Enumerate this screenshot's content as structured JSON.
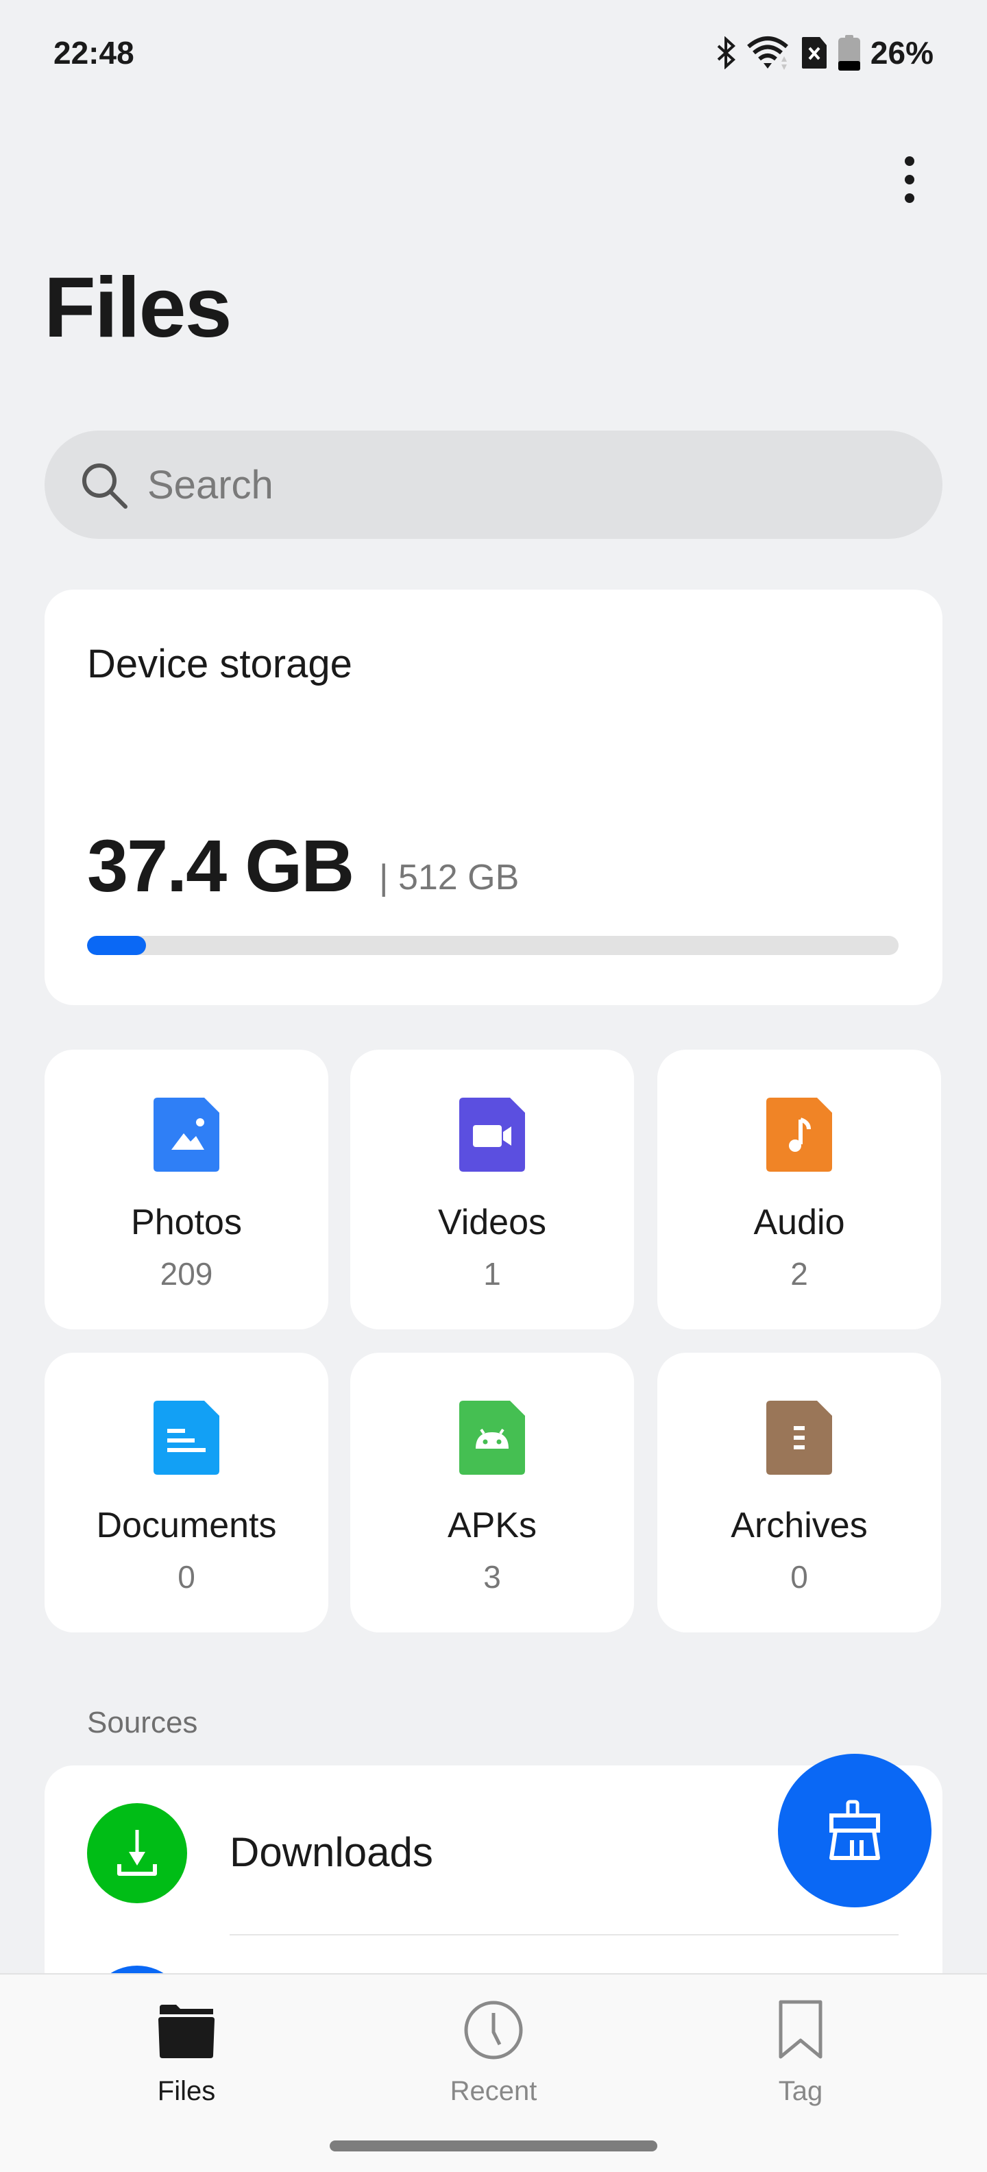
{
  "status_bar": {
    "time": "22:48",
    "battery": "26%",
    "icons": [
      "bluetooth-icon",
      "wifi-icon",
      "no-sim-icon",
      "battery-icon"
    ]
  },
  "header": {
    "title": "Files",
    "menu_icon": "more-vertical-icon"
  },
  "search": {
    "placeholder": "Search"
  },
  "storage": {
    "title": "Device storage",
    "used": "37.4 GB",
    "total_label": "| 512 GB",
    "used_fraction": 0.073,
    "accent": "#0a68f5"
  },
  "categories": [
    {
      "label": "Photos",
      "count": "209",
      "color": "#2f7ff6",
      "icon": "image-icon"
    },
    {
      "label": "Videos",
      "count": "1",
      "color": "#5b4fe0",
      "icon": "video-icon"
    },
    {
      "label": "Audio",
      "count": "2",
      "color": "#f08426",
      "icon": "music-icon"
    },
    {
      "label": "Documents",
      "count": "0",
      "color": "#12a0f5",
      "icon": "document-icon"
    },
    {
      "label": "APKs",
      "count": "3",
      "color": "#45bf52",
      "icon": "android-icon"
    },
    {
      "label": "Archives",
      "count": "0",
      "color": "#9a7658",
      "icon": "archive-icon"
    }
  ],
  "sources": {
    "label": "Sources",
    "items": [
      {
        "label": "Downloads",
        "color": "#00bd16"
      }
    ]
  },
  "fab": {
    "icon": "clean-brush-icon",
    "color": "#0a68f5"
  },
  "bottom_nav": [
    {
      "label": "Files",
      "active": true
    },
    {
      "label": "Recent",
      "active": false
    },
    {
      "label": "Tag",
      "active": false
    }
  ]
}
